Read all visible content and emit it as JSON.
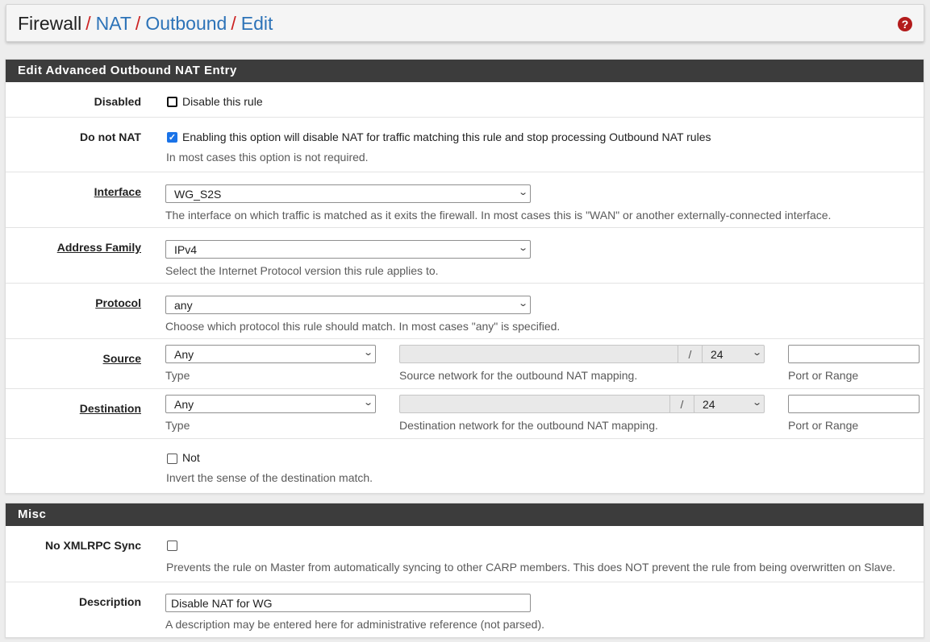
{
  "breadcrumb": {
    "items": [
      "Firewall",
      "NAT",
      "Outbound",
      "Edit"
    ],
    "separator": "/"
  },
  "help_icon": "question-circle-icon",
  "panels": {
    "edit": {
      "title": "Edit Advanced Outbound NAT Entry"
    },
    "misc": {
      "title": "Misc"
    }
  },
  "form": {
    "disabled": {
      "label": "Disabled",
      "checkbox_label": "Disable this rule",
      "checked": false
    },
    "do_not_nat": {
      "label": "Do not NAT",
      "checkbox_label": "Enabling this option will disable NAT for traffic matching this rule and stop processing Outbound NAT rules",
      "help": "In most cases this option is not required.",
      "checked": true
    },
    "interface": {
      "label": "Interface",
      "value": "WG_S2S",
      "help": "The interface on which traffic is matched as it exits the firewall. In most cases this is \"WAN\" or another externally-connected interface."
    },
    "address_family": {
      "label": "Address Family",
      "value": "IPv4",
      "help": "Select the Internet Protocol version this rule applies to."
    },
    "protocol": {
      "label": "Protocol",
      "value": "any",
      "help": "Choose which protocol this rule should match. In most cases \"any\" is specified."
    },
    "source": {
      "label": "Source",
      "type_value": "Any",
      "type_help": "Type",
      "network_value": "",
      "slash": "/",
      "mask_value": "24",
      "network_help": "Source network for the outbound NAT mapping.",
      "port_value": "",
      "port_help": "Port or Range"
    },
    "destination": {
      "label": "Destination",
      "type_value": "Any",
      "type_help": "Type",
      "network_value": "",
      "slash": "/",
      "mask_value": "24",
      "network_help": "Destination network for the outbound NAT mapping.",
      "port_value": "",
      "port_help": "Port or Range"
    },
    "not": {
      "checkbox_label": "Not",
      "checked": false,
      "help": "Invert the sense of the destination match."
    },
    "no_xmlrpc_sync": {
      "label": "No XMLRPC Sync",
      "checked": false,
      "help": "Prevents the rule on Master from automatically syncing to other CARP members. This does NOT prevent the rule from being overwritten on Slave."
    },
    "description": {
      "label": "Description",
      "value": "Disable NAT for WG",
      "help": "A description may be entered here for administrative reference (not parsed)."
    }
  },
  "colors": {
    "panel_header_bg": "#3c3c3c",
    "link": "#2d73b8",
    "breadcrumb_separator": "#cc2222",
    "help_icon": "#b31b1b",
    "checkbox_checked": "#1a73e8"
  }
}
